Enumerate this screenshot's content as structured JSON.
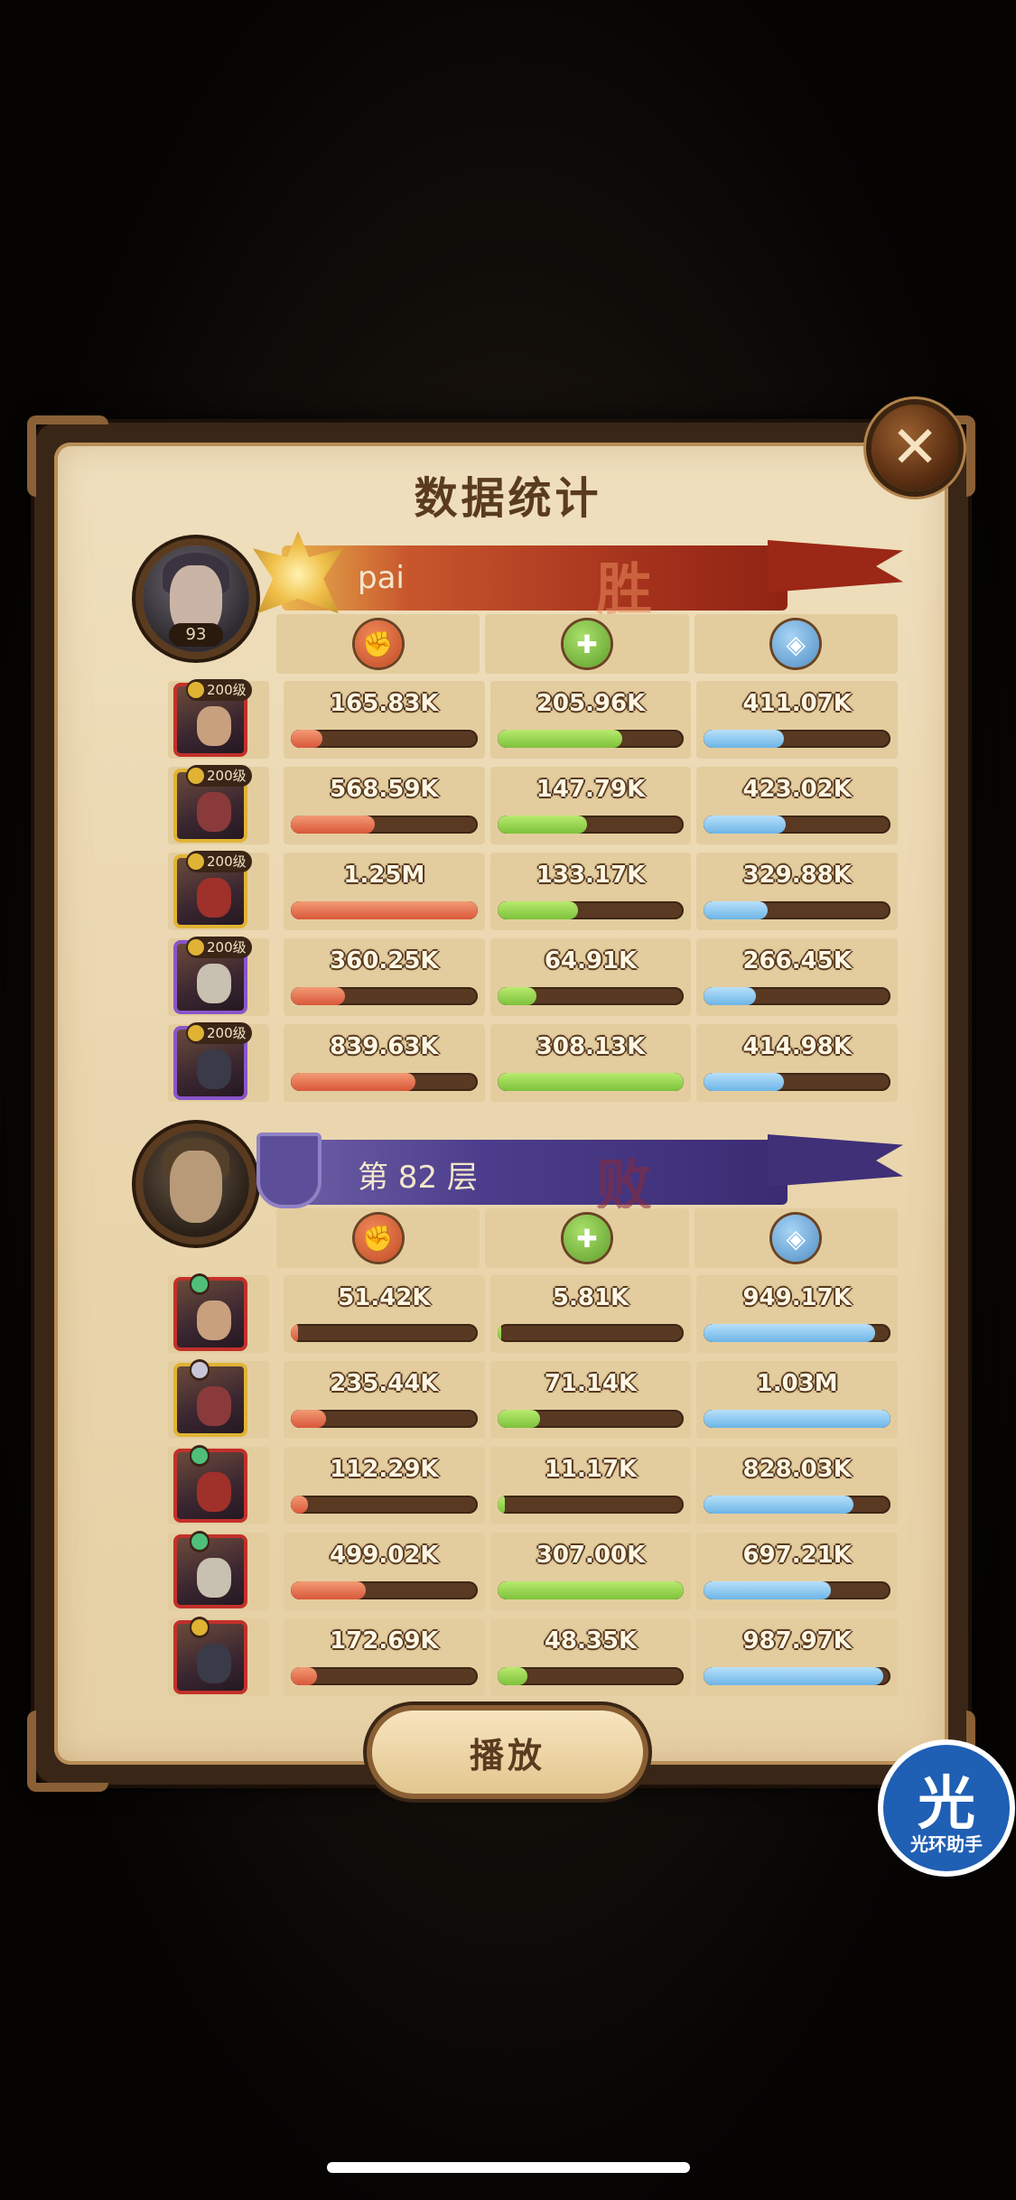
{
  "screen": {
    "title": "数据统计",
    "close_label": "✕",
    "play_label": "播放",
    "watermark": {
      "glyph": "光",
      "text": "光环助手"
    }
  },
  "team_a": {
    "name": "pai",
    "level": "93",
    "result": "胜",
    "icons": [
      "damage-icon",
      "heal-icon",
      "shield-icon"
    ],
    "heroes": [
      {
        "tier": "200级",
        "frame": "red",
        "damage": "165.83K",
        "heal": "205.96K",
        "defense": "411.07K",
        "damage_pct": 17,
        "heal_pct": 67,
        "defense_pct": 43
      },
      {
        "tier": "200级",
        "frame": "gold",
        "damage": "568.59K",
        "heal": "147.79K",
        "defense": "423.02K",
        "damage_pct": 45,
        "heal_pct": 48,
        "defense_pct": 44
      },
      {
        "tier": "200级",
        "frame": "gold",
        "damage": "1.25M",
        "heal": "133.17K",
        "defense": "329.88K",
        "damage_pct": 100,
        "heal_pct": 43,
        "defense_pct": 34
      },
      {
        "tier": "200级",
        "frame": "purple",
        "damage": "360.25K",
        "heal": "64.91K",
        "defense": "266.45K",
        "damage_pct": 29,
        "heal_pct": 21,
        "defense_pct": 28
      },
      {
        "tier": "200级",
        "frame": "purple",
        "damage": "839.63K",
        "heal": "308.13K",
        "defense": "414.98K",
        "damage_pct": 67,
        "heal_pct": 100,
        "defense_pct": 43
      }
    ]
  },
  "team_b": {
    "name": "第 82 层",
    "result": "败",
    "icons": [
      "damage-icon",
      "heal-icon",
      "shield-icon"
    ],
    "heroes": [
      {
        "gem": "green",
        "frame": "red",
        "damage": "51.42K",
        "heal": "5.81K",
        "defense": "949.17K",
        "damage_pct": 4,
        "heal_pct": 2,
        "defense_pct": 92
      },
      {
        "gem": "white",
        "frame": "gold",
        "damage": "235.44K",
        "heal": "71.14K",
        "defense": "1.03M",
        "damage_pct": 19,
        "heal_pct": 23,
        "defense_pct": 100
      },
      {
        "gem": "green",
        "frame": "red",
        "damage": "112.29K",
        "heal": "11.17K",
        "defense": "828.03K",
        "damage_pct": 9,
        "heal_pct": 4,
        "defense_pct": 80
      },
      {
        "gem": "green",
        "frame": "red",
        "damage": "499.02K",
        "heal": "307.00K",
        "defense": "697.21K",
        "damage_pct": 40,
        "heal_pct": 100,
        "defense_pct": 68
      },
      {
        "gem": "gold",
        "frame": "red",
        "damage": "172.69K",
        "heal": "48.35K",
        "defense": "987.97K",
        "damage_pct": 14,
        "heal_pct": 16,
        "defense_pct": 96
      }
    ]
  },
  "colors": {
    "damage": "#d9573a",
    "heal": "#7cc23a",
    "defense": "#6db5e6",
    "win_banner": "#a5321c",
    "lose_banner": "#3a2c72"
  }
}
